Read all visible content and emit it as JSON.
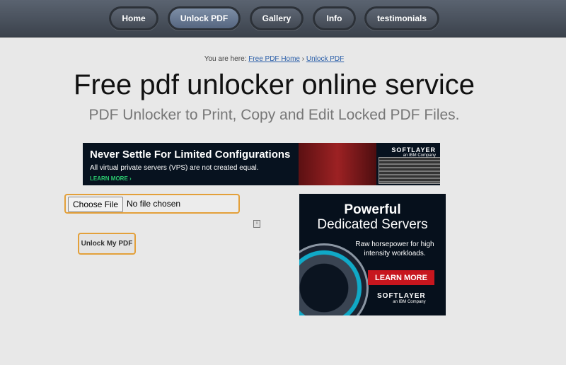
{
  "nav": {
    "items": [
      {
        "label": "Home"
      },
      {
        "label": "Unlock PDF",
        "active": true
      },
      {
        "label": "Gallery"
      },
      {
        "label": "Info"
      },
      {
        "label": "testimonials"
      }
    ]
  },
  "breadcrumb": {
    "prefix": "You are here:",
    "home_link": "Free PDF Home",
    "separator": "›",
    "current_link": "Unlock PDF"
  },
  "page": {
    "title": "Free pdf unlocker online service",
    "subtitle": "PDF Unlocker to Print, Copy and Edit Locked PDF Files."
  },
  "banner_ad": {
    "headline": "Never Settle For Limited Configurations",
    "sub": "All virtual private servers (VPS) are not created equal.",
    "cta": "LEARN MORE ›",
    "brand": "SOFTLAYER",
    "brand_sub": "an IBM Company"
  },
  "form": {
    "choose_file_label": "Choose File",
    "no_file_text": "No file chosen",
    "submit_label": "Unlock My PDF"
  },
  "side_ad": {
    "headline1": "Powerful",
    "headline2": "Dedicated Servers",
    "body": "Raw horsepower for high intensity workloads.",
    "cta": "LEARN MORE",
    "brand": "SOFTLAYER",
    "brand_sub": "an IBM Company"
  },
  "colors": {
    "accent_border": "#e3a03a",
    "link": "#2a5ea8",
    "ad_red": "#c7161e"
  }
}
